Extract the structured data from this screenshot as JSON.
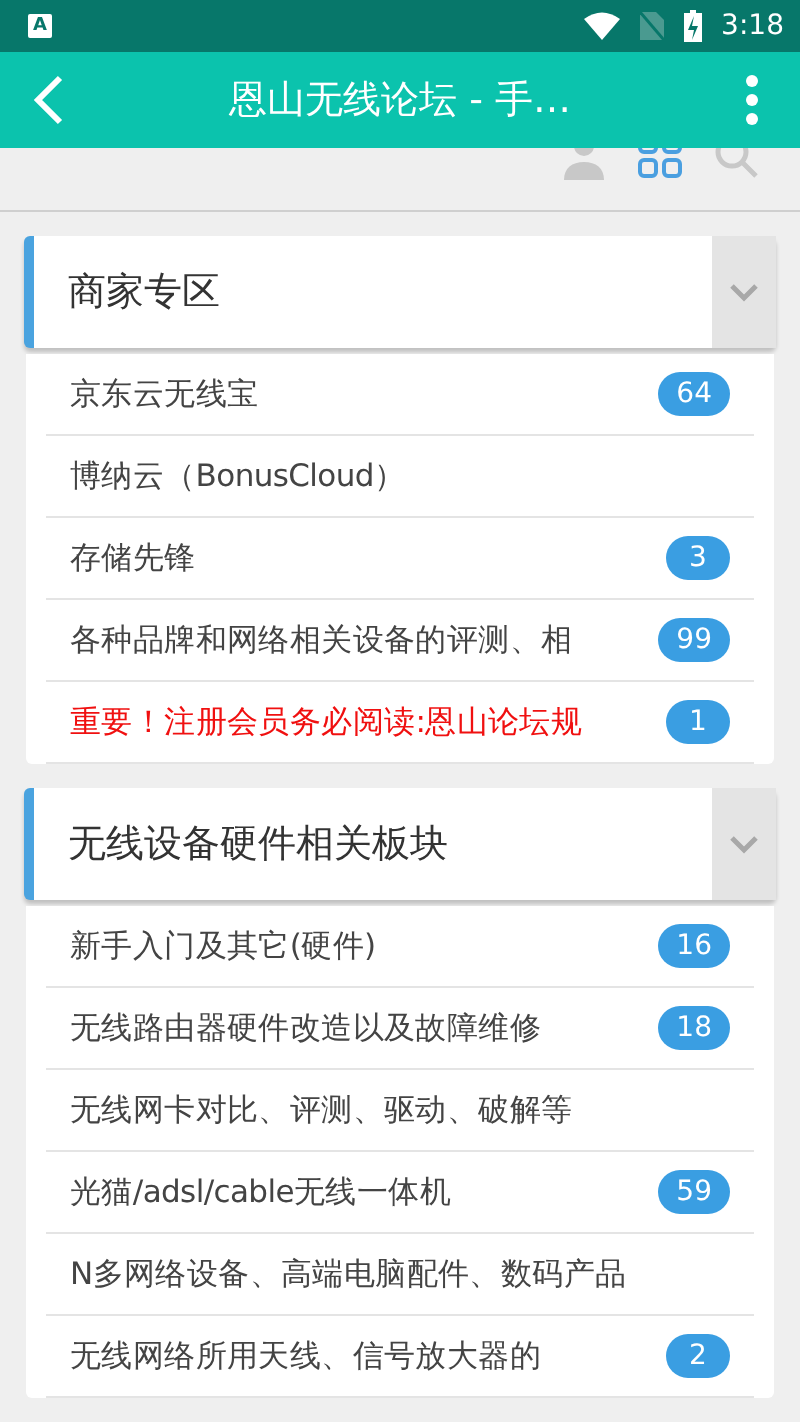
{
  "status_bar": {
    "notification": "A",
    "time": "3:18"
  },
  "app_bar": {
    "title": "恩山无线论坛 - 手…"
  },
  "tabs": [
    {
      "kind": "person",
      "selected": false
    },
    {
      "kind": "grid",
      "selected": true
    },
    {
      "kind": "search",
      "selected": false
    }
  ],
  "sections": [
    {
      "title": "商家专区",
      "expanded": true,
      "forums": [
        {
          "name": "京东云无线宝",
          "badge": "64",
          "important": false
        },
        {
          "name": "博纳云（BonusCloud）",
          "important": false
        },
        {
          "name": "存储先锋",
          "badge": "3",
          "important": false
        },
        {
          "name": "各种品牌和网络相关设备的评测、相",
          "badge": "99",
          "important": false
        },
        {
          "name": "重要！注册会员务必阅读:恩山论坛规",
          "badge": "1",
          "important": true
        }
      ]
    },
    {
      "title": "无线设备硬件相关板块",
      "expanded": true,
      "forums": [
        {
          "name": "新手入门及其它(硬件)",
          "badge": "16",
          "important": false
        },
        {
          "name": "无线路由器硬件改造以及故障维修",
          "badge": "18",
          "important": false
        },
        {
          "name": "无线网卡对比、评测、驱动、破解等",
          "important": false
        },
        {
          "name": "光猫/adsl/cable无线一体机",
          "badge": "59",
          "important": false
        },
        {
          "name": "N多网络设备、高端电脑配件、数码产品",
          "important": false
        },
        {
          "name": "无线网络所用天线、信号放大器的",
          "badge": "2",
          "important": false
        }
      ]
    }
  ]
}
